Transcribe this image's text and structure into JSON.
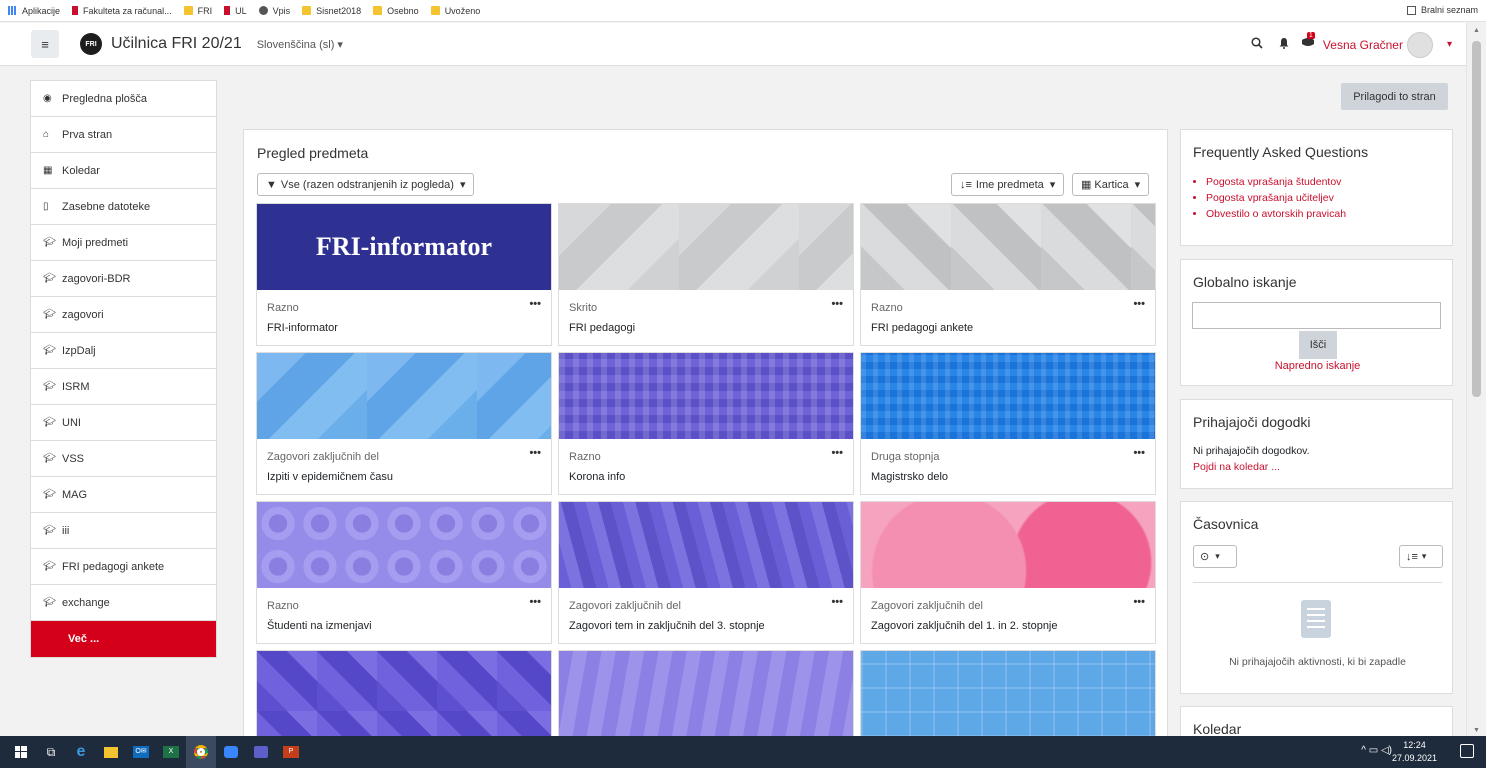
{
  "bookmarks": {
    "items": [
      "Aplikacije",
      "Fakulteta za računal...",
      "FRI",
      "UL",
      "Vpis",
      "Sisnet2018",
      "Osebno",
      "Uvoženo"
    ],
    "reading_list": "Bralni seznam"
  },
  "navbar": {
    "site_name": "Učilnica FRI 20/21",
    "logo_text": "FRI",
    "language": "Slovenščina (sl)",
    "username": "Vesna Gračner",
    "notif_badge": "1"
  },
  "sidebar": {
    "items": [
      "Pregledna plošča",
      "Prva stran",
      "Koledar",
      "Zasebne datoteke",
      "Moji predmeti",
      "zagovori-BDR",
      "zagovori",
      "IzpDalj",
      "ISRM",
      "UNI",
      "VSS",
      "MAG",
      "iii",
      "FRI pedagogi ankete",
      "exchange"
    ],
    "more": "Več ..."
  },
  "customise_button": "Prilagodi to stran",
  "main": {
    "title": "Pregled predmeta",
    "filter": "Vse (razen odstranjenih iz pogleda)",
    "sort": "Ime predmeta",
    "view": "Kartica",
    "cards": [
      {
        "category": "Razno",
        "name": "FRI-informator",
        "banner": "FRI-informator"
      },
      {
        "category": "Skrito",
        "name": "FRI pedagogi"
      },
      {
        "category": "Razno",
        "name": "FRI pedagogi ankete"
      },
      {
        "category": "Zagovori zaključnih del",
        "name": "Izpiti v epidemičnem času"
      },
      {
        "category": "Razno",
        "name": "Korona info"
      },
      {
        "category": "Druga stopnja",
        "name": "Magistrsko delo"
      },
      {
        "category": "Razno",
        "name": "Študenti na izmenjavi"
      },
      {
        "category": "Zagovori zaključnih del",
        "name": "Zagovori tem in zaključnih del 3. stopnje"
      },
      {
        "category": "Zagovori zaključnih del",
        "name": "Zagovori zaključnih del 1. in 2. stopnje"
      }
    ]
  },
  "faq": {
    "title": "Frequently Asked Questions",
    "links": [
      "Pogosta vprašanja študentov",
      "Pogosta vprašanja učiteljev",
      "Obvestilo o avtorskih pravicah"
    ]
  },
  "search": {
    "title": "Globalno iskanje",
    "button": "Išči",
    "advanced": "Napredno iskanje"
  },
  "events": {
    "title": "Prihajajoči dogodki",
    "none": "Ni prihajajočih dogodkov.",
    "link": "Pojdi na koledar ..."
  },
  "timeline": {
    "title": "Časovnica",
    "empty": "Ni prihajajočih aktivnosti, ki bi zapadle"
  },
  "calendar": {
    "title": "Koledar"
  },
  "taskbar": {
    "time": "12:24",
    "date": "27.09.2021"
  },
  "colors": {
    "accent": "#c8102e",
    "more_bg": "#d4001a"
  }
}
